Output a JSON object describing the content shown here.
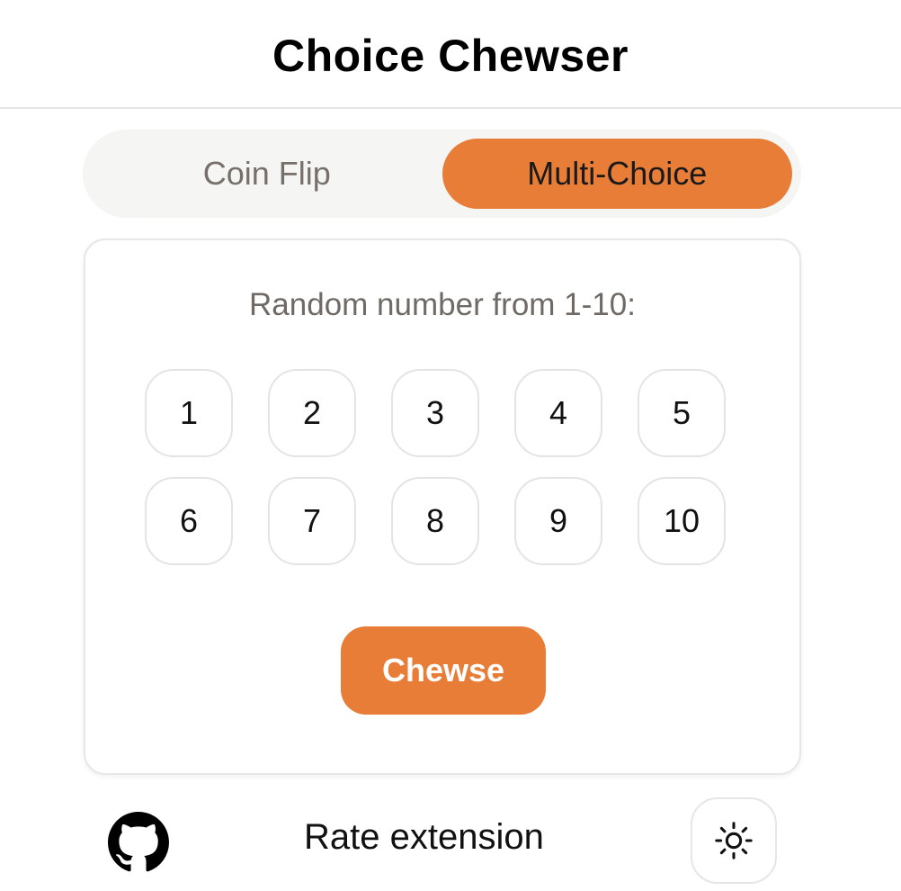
{
  "header": {
    "title": "Choice Chewser"
  },
  "tabs": [
    {
      "label": "Coin Flip",
      "active": false
    },
    {
      "label": "Multi-Choice",
      "active": true
    }
  ],
  "main": {
    "prompt": "Random number from 1-10:",
    "numbers": [
      "1",
      "2",
      "3",
      "4",
      "5",
      "6",
      "7",
      "8",
      "9",
      "10"
    ],
    "action_label": "Chewse"
  },
  "footer": {
    "github_icon": "github-icon",
    "rate_label": "Rate extension",
    "theme_icon": "sun-icon"
  },
  "colors": {
    "accent": "#e87d37",
    "tab_track": "#f5f5f4",
    "muted_text": "#6f6a66",
    "border": "#e6e6e6"
  }
}
